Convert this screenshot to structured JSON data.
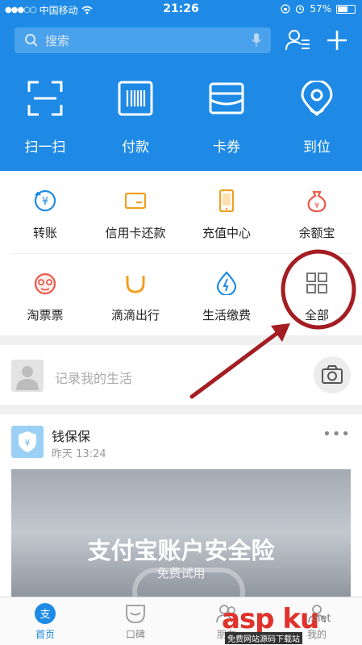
{
  "status": {
    "carrier": "中国移动",
    "time": "21:26",
    "battery": "57%"
  },
  "search": {
    "placeholder": "搜索"
  },
  "quick_actions": [
    {
      "label": "扫一扫",
      "icon": "scan-icon"
    },
    {
      "label": "付款",
      "icon": "barcode-icon"
    },
    {
      "label": "卡券",
      "icon": "card-wallet-icon"
    },
    {
      "label": "到位",
      "icon": "location-pin-icon"
    }
  ],
  "services": [
    {
      "label": "转账",
      "icon": "transfer-icon",
      "color": "#1e8ae6"
    },
    {
      "label": "信用卡还款",
      "icon": "credit-card-icon",
      "color": "#f0a020"
    },
    {
      "label": "充值中心",
      "icon": "phone-topup-icon",
      "color": "#f0a020"
    },
    {
      "label": "余额宝",
      "icon": "money-bag-icon",
      "color": "#e85a4a"
    },
    {
      "label": "淘票票",
      "icon": "taopiaopiao-icon",
      "color": "#e85a4a"
    },
    {
      "label": "滴滴出行",
      "icon": "didi-icon",
      "color": "#f0a020"
    },
    {
      "label": "生活缴费",
      "icon": "water-drop-icon",
      "color": "#1e8ae6"
    },
    {
      "label": "全部",
      "icon": "grid-all-icon",
      "color": "#777777"
    }
  ],
  "record": {
    "placeholder": "记录我的生活"
  },
  "card": {
    "title": "钱保保",
    "time": "昨天 13:24",
    "banner_title": "支付宝账户安全险",
    "banner_subtitle": "免费试用"
  },
  "tabs": [
    {
      "label": "首页",
      "active": true
    },
    {
      "label": "口碑",
      "active": false
    },
    {
      "label": "朋友",
      "active": false
    },
    {
      "label": "我的",
      "active": false
    }
  ],
  "watermark": {
    "brand": "asp ku",
    "domain": ".net",
    "tagline": "免费网站源码下载站"
  },
  "colors": {
    "primary": "#1e8ae6",
    "annotation": "#a31d22"
  }
}
